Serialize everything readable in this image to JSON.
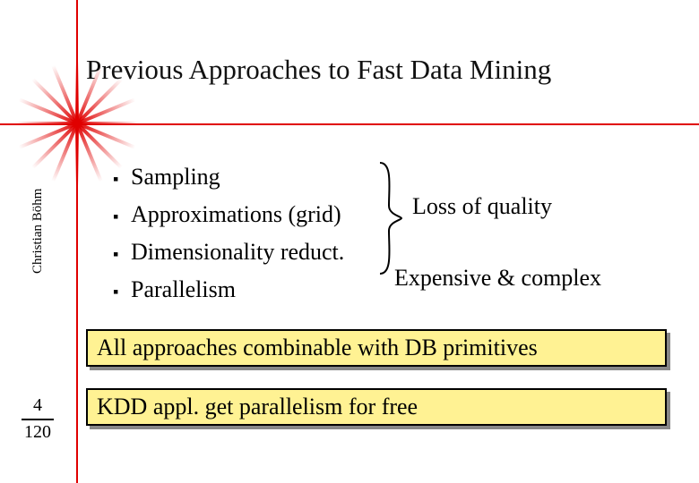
{
  "title": "Previous Approaches to Fast Data Mining",
  "author": "Christian Böhm",
  "page": {
    "current": "4",
    "total": "120"
  },
  "bullets": [
    {
      "mark": "▪",
      "text": "Sampling"
    },
    {
      "mark": "▪",
      "text": "Approximations (grid)"
    },
    {
      "mark": "▪",
      "text": "Dimensionality reduct."
    },
    {
      "mark": "▪",
      "text": "Parallelism"
    }
  ],
  "notes": {
    "quality": "Loss of quality",
    "expensive": "Expensive & complex"
  },
  "highlights": {
    "combine": "All approaches combinable with DB primitives",
    "free": "KDD appl. get parallelism for free"
  }
}
